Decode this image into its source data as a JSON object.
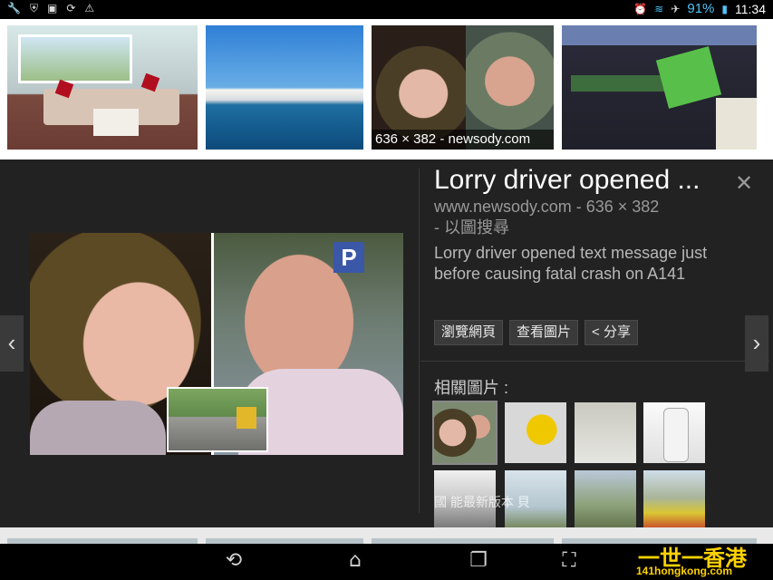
{
  "status_bar": {
    "left_icons": [
      "wrench-icon",
      "shield-icon",
      "image-icon",
      "sync-icon",
      "warning-icon"
    ],
    "right_icons": [
      "alarm-icon",
      "wifi-icon",
      "airplane-icon"
    ],
    "battery": "91%",
    "time": "11:34"
  },
  "results_strip": {
    "thumbnails": [
      {
        "name": "caravan-lounge"
      },
      {
        "name": "seaside-buildings"
      },
      {
        "name": "newsody-faces",
        "caption": "636 × 382 - newsody.com"
      },
      {
        "name": "cad-model"
      }
    ]
  },
  "preview": {
    "title": "Lorry driver opened ...",
    "source": "www.newsody.com - 636 × 382",
    "search_by_image": "- 以圖搜尋",
    "description": "Lorry driver opened text message just before causing fatal crash on A141",
    "buttons": {
      "visit_page": "瀏覽網頁",
      "view_image": "查看圖片",
      "share": "< 分享"
    },
    "related_label": "相關圖片 :",
    "related_overlay": "國     能最新版本     貝",
    "main_image_badge": "P"
  },
  "system_nav": {
    "back": "back-icon",
    "home": "home-icon",
    "recents": "recents-icon",
    "screenshot": "screenshot-icon"
  },
  "watermark": {
    "big": "一世一香港",
    "small": "141hongkong.com"
  }
}
